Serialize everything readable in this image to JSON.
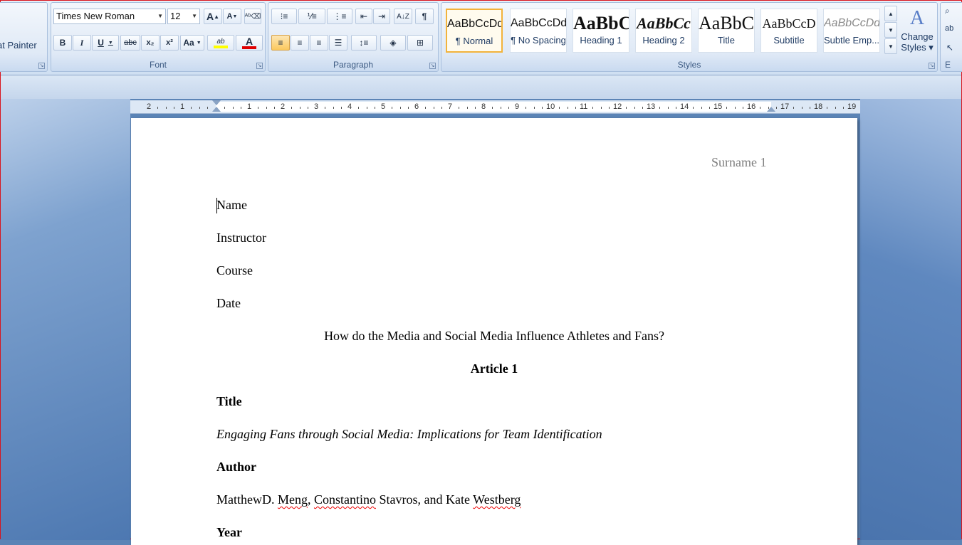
{
  "clipboard": {
    "format_painter_label": "at Painter"
  },
  "font": {
    "family": "Times New Roman",
    "size": "12",
    "group_label": "Font",
    "grow_label": "A",
    "shrink_label": "A",
    "bold": "B",
    "italic": "I",
    "underline": "U",
    "strike": "abc",
    "subscript": "x₂",
    "superscript": "x²",
    "case": "Aa",
    "highlight": "ab",
    "color": "A"
  },
  "paragraph": {
    "group_label": "Paragraph"
  },
  "styles": {
    "group_label": "Styles",
    "tiles": [
      {
        "sample": "AaBbCcDd",
        "name": "¶ Normal"
      },
      {
        "sample": "AaBbCcDd",
        "name": "¶ No Spacing"
      },
      {
        "sample": "AaBbC",
        "name": "Heading 1"
      },
      {
        "sample": "AaBbCc",
        "name": "Heading 2"
      },
      {
        "sample": "AaBbC",
        "name": "Title"
      },
      {
        "sample": "AaBbCcD",
        "name": "Subtitle"
      },
      {
        "sample": "AaBbCcDd",
        "name": "Subtle Emp..."
      }
    ],
    "change_styles_line1": "Change",
    "change_styles_line2": "Styles ▾"
  },
  "editing": {
    "group_label": "E"
  },
  "ruler": {
    "left_numbers": [
      "2",
      "1"
    ],
    "right_numbers": [
      "1",
      "2",
      "3",
      "4",
      "5",
      "6",
      "7",
      "8",
      "9",
      "10",
      "11",
      "12",
      "13",
      "14",
      "15",
      "16",
      "17",
      "18",
      "19"
    ]
  },
  "document": {
    "header": "Surname 1",
    "name": "Name",
    "instructor": "Instructor",
    "course": "Course",
    "date": "Date",
    "question": "How do the Media and Social Media Influence Athletes and Fans?",
    "article_heading": "Article 1",
    "title_label": "Title",
    "title_text": "Engaging Fans through Social Media: Implications for Team Identification",
    "author_label": "Author",
    "author_parts": [
      "MatthewD. ",
      "Meng",
      ", ",
      "Constantino",
      " Stavros, and Kate ",
      "Westberg"
    ],
    "year_label": "Year"
  },
  "colors": {
    "accent": "#f2b33b",
    "header_gray": "#7f7f7f",
    "font_color_bar": "#e00000",
    "highlight_bar": "#ffff00"
  }
}
